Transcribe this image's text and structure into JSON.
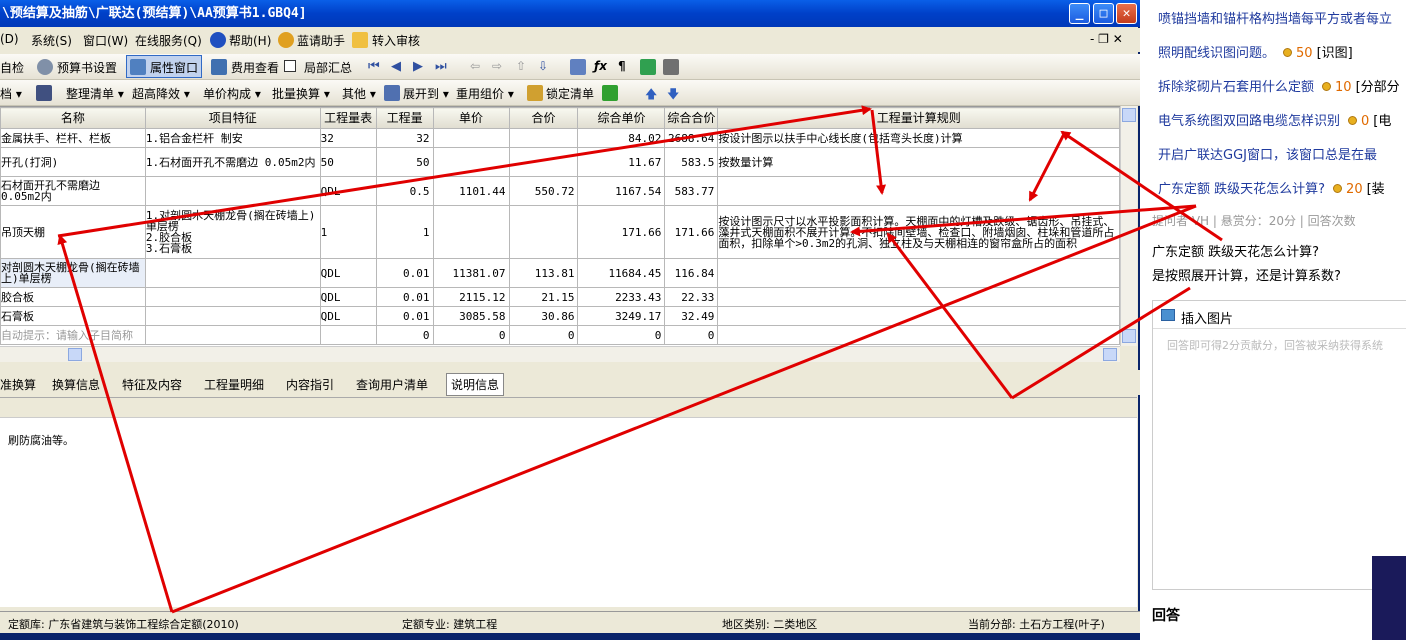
{
  "window": {
    "title": "\\预结算及抽筋\\广联达(预结算)\\AA预算书1.GBQ4]",
    "min_label": "_",
    "max_label": "□",
    "close_label": "✕"
  },
  "menu": {
    "items": [
      "(D)",
      "系统(S)",
      "窗口(W)",
      "在线服务(Q)",
      "帮助(H)",
      "蓝请助手",
      "转入审核"
    ],
    "right_controls": "- ❐ ✕"
  },
  "toolbar1": {
    "items": [
      "自检",
      "预算书设置",
      "属性窗口",
      "费用查看",
      "局部汇总"
    ]
  },
  "toolbar2": {
    "items": [
      "档 ▾",
      "整理清单 ▾",
      "超高降效 ▾",
      "单价构成 ▾",
      "批量换算 ▾",
      "其他 ▾",
      "展开到 ▾",
      "重用组价 ▾",
      "锁定清单"
    ]
  },
  "grid": {
    "headers": [
      "名称",
      "项目特征",
      "工程量表",
      "工程量",
      "单价",
      "合价",
      "综合单价",
      "综合合价",
      "工程量计算规则"
    ],
    "rows": [
      {
        "name": "金属扶手、栏杆、栏板",
        "feature": "1.铝合金栏杆 制安",
        "expr": "32",
        "qty": "32",
        "price": "",
        "total": "",
        "uprice": "84.02",
        "utotal": "2688.64",
        "rule": "按设计图示以扶手中心线长度(包括弯头长度)计算"
      },
      {
        "name": "开孔(打洞)",
        "feature": "1.石材面开孔不需磨边 0.05m2内",
        "expr": "50",
        "qty": "50",
        "price": "",
        "total": "",
        "uprice": "11.67",
        "utotal": "583.5",
        "rule": "按数量计算"
      },
      {
        "name": "石材面开孔不需磨边 0.05m2内",
        "feature": "",
        "expr": "QDL",
        "qty": "0.5",
        "price": "1101.44",
        "total": "550.72",
        "uprice": "1167.54",
        "utotal": "583.77",
        "rule": ""
      },
      {
        "name": "吊顶天棚",
        "feature": "1.对剖圆木天棚龙骨(搁在砖墙上)单层楞\n2.胶合板\n3.石膏板",
        "expr": "1",
        "qty": "1",
        "price": "",
        "total": "",
        "uprice": "171.66",
        "utotal": "171.66",
        "rule": "按设计图示尺寸以水平投影面积计算。天棚面中的灯槽及跌级、锯齿形、吊挂式、藻井式天棚面积不展开计算。不扣除间壁墙、检查口、附墙烟囱、柱垛和管道所占面积，扣除单个>0.3m2的孔洞、独立柱及与天棚相连的窗帘盒所占的面积"
      },
      {
        "name": "对剖圆木天棚龙骨(搁在砖墙上)单层楞",
        "feature": "",
        "expr": "QDL",
        "qty": "0.01",
        "price": "11381.07",
        "total": "113.81",
        "uprice": "11684.45",
        "utotal": "116.84",
        "rule": ""
      },
      {
        "name": "胶合板",
        "feature": "",
        "expr": "QDL",
        "qty": "0.01",
        "price": "2115.12",
        "total": "21.15",
        "uprice": "2233.43",
        "utotal": "22.33",
        "rule": ""
      },
      {
        "name": "石膏板",
        "feature": "",
        "expr": "QDL",
        "qty": "0.01",
        "price": "3085.58",
        "total": "30.86",
        "uprice": "3249.17",
        "utotal": "32.49",
        "rule": ""
      },
      {
        "name": "自动提示：请输入子目简称",
        "feature": "",
        "expr": "",
        "qty": "0",
        "price": "0",
        "total": "0",
        "uprice": "0",
        "utotal": "0",
        "rule": ""
      }
    ]
  },
  "bottom_tabs": [
    "准换算",
    "换算信息",
    "特征及内容",
    "工程量明细",
    "内容指引",
    "查询用户清单",
    "说明信息"
  ],
  "panel": {
    "text": "刷防腐油等。"
  },
  "status": {
    "lib": "定额库: 广东省建筑与装饰工程综合定额(2010)",
    "major": "定额专业: 建筑工程",
    "region": "地区类别: 二类地区",
    "section": "当前分部: 土石方工程(叶子)"
  },
  "right": {
    "questions": [
      {
        "text": "喷锚挡墙和锚杆格构挡墙每平方或者每立",
        "score": "",
        "tag": ""
      },
      {
        "text": "照明配线识图问题。",
        "score": "50",
        "tag": "[识图]"
      },
      {
        "text": "拆除浆砌片石套用什么定额",
        "score": "10",
        "tag": "[分部分"
      },
      {
        "text": "电气系统图双回路电缆怎样识别",
        "score": "0",
        "tag": "[电"
      },
      {
        "text": "开启广联达GGJ窗口，该窗口总是在最",
        "score": "",
        "tag": ""
      },
      {
        "text": "广东定额 跌级天花怎么计算?",
        "score": "20",
        "tag": "[装"
      }
    ],
    "meta": "提问者 VH  |  悬赏分：20分  |  回答次数",
    "q_title": "广东定额 跌级天花怎么计算?",
    "q_desc": "是按照展开计算，还是计算系数?",
    "insert_image": "插入图片",
    "placeholder": "回答即可得2分贡献分，回答被采纳获得系统",
    "answer_label": "回答"
  },
  "colors": {
    "arrow": "#E00000",
    "title_bar": "#0A5FE8",
    "link": "#1F3A9E"
  }
}
